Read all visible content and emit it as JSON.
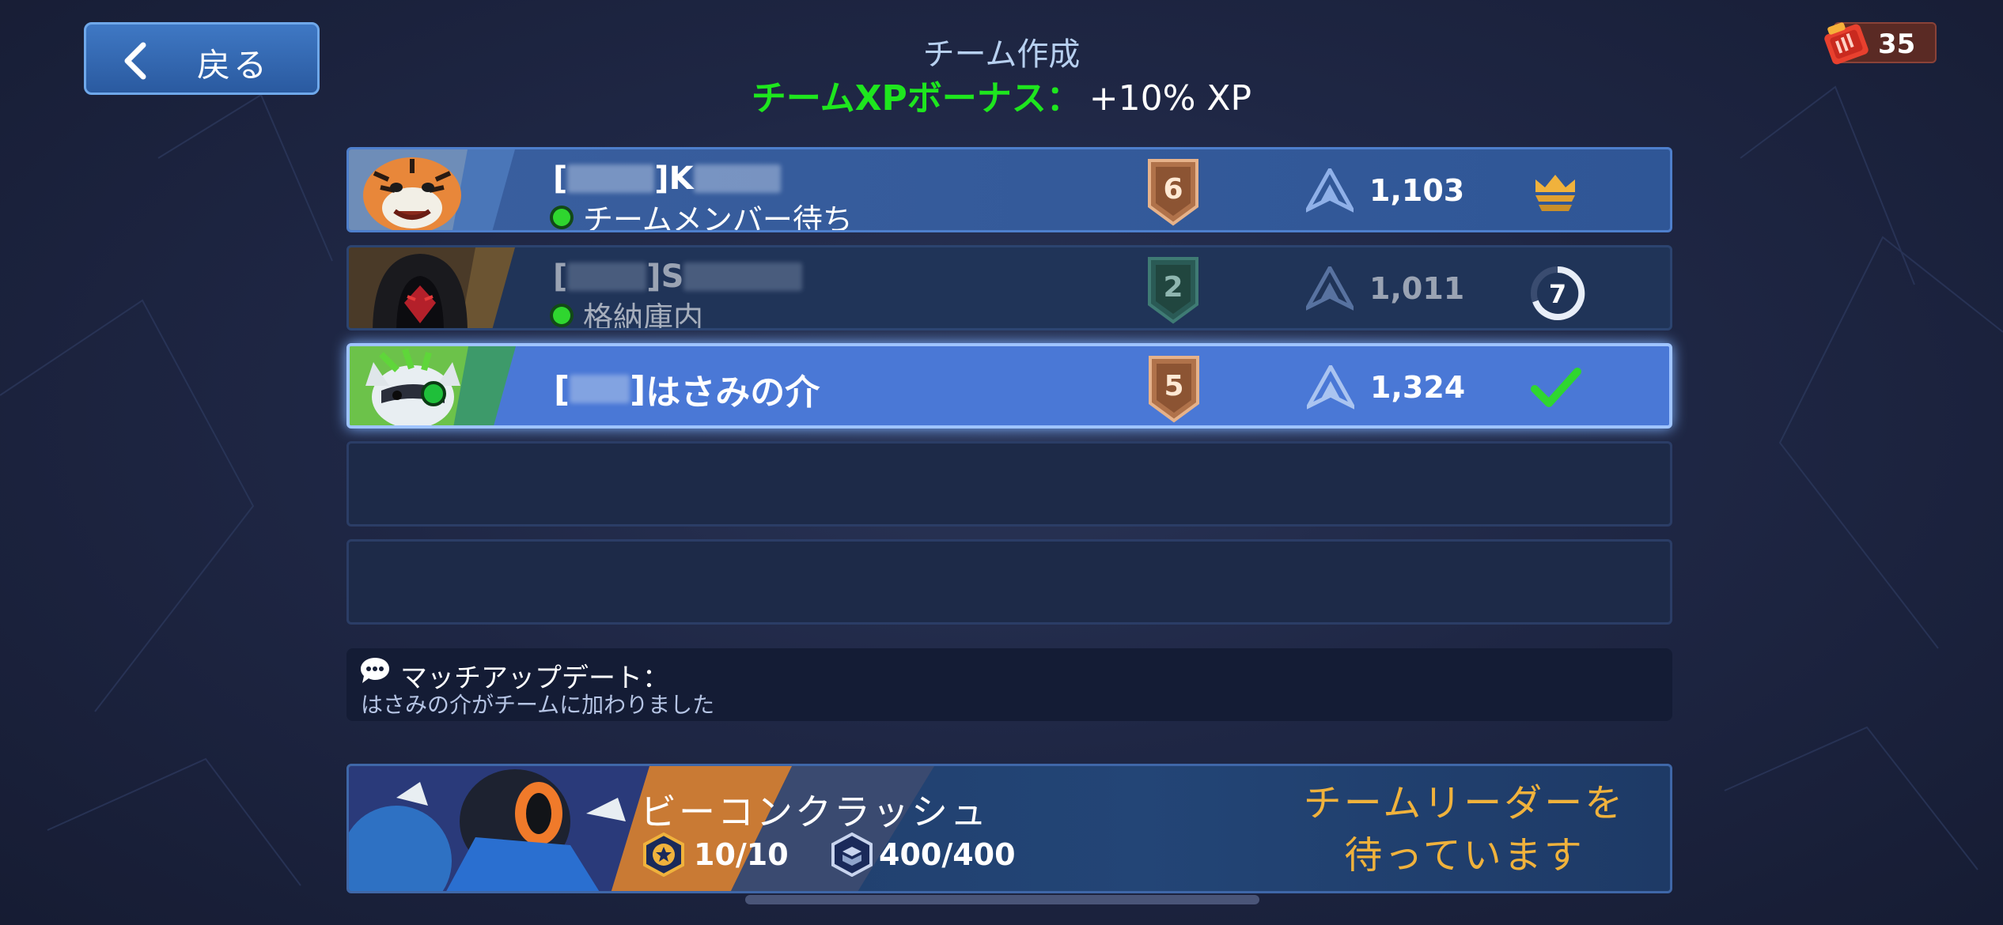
{
  "header": {
    "back_label": "戻る",
    "title": "チーム作成",
    "bonus_label": "チームXPボーナス：",
    "bonus_value": "+10% XP",
    "currency_value": "35"
  },
  "members": [
    {
      "name_prefix": "[",
      "name_mid": "]",
      "name_suffix": "K",
      "status": "チームメンバー待ち",
      "level": "6",
      "rank_score": "1,103",
      "state_icon": "crown-icon"
    },
    {
      "name_prefix": "[",
      "name_mid": "]",
      "name_suffix": "S",
      "status": "格納庫内",
      "level": "2",
      "rank_score": "1,011",
      "state_icon": "timer-icon",
      "timer_value": "7"
    },
    {
      "name_prefix": "[",
      "name_mid": "]",
      "name_suffix": "はさみの介",
      "level": "5",
      "rank_score": "1,324",
      "state_icon": "check-icon"
    }
  ],
  "match_update": {
    "title": "マッチアップデート：",
    "message": "はさみの介がチームに加わりました"
  },
  "mode": {
    "name": "ビーコンクラッシュ",
    "stat1": "10/10",
    "stat2": "400/400",
    "wait_text_line1": "チームリーダーを",
    "wait_text_line2": "待っています"
  },
  "colors": {
    "bonus_green": "#1ee61e",
    "wait_orange": "#f0b23c",
    "selected_row": "#4a78d6",
    "check_green": "#2fd62f"
  }
}
